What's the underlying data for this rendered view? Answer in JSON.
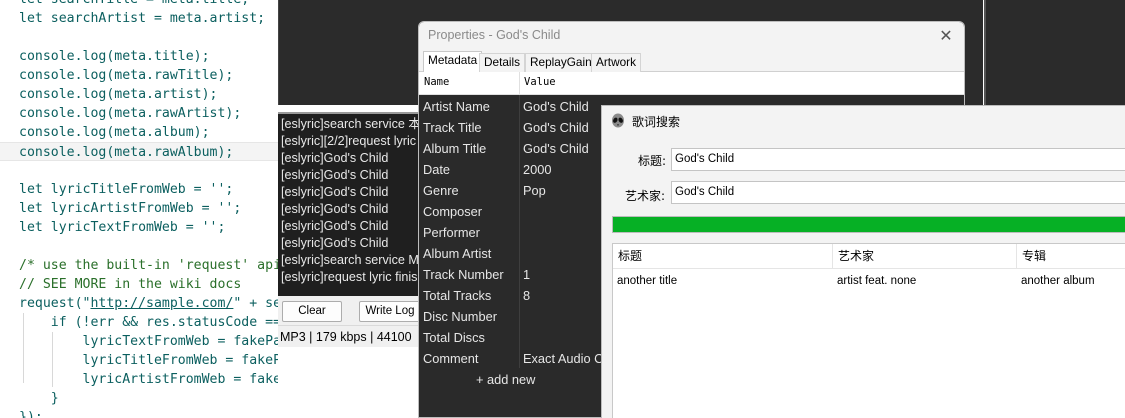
{
  "editor": {
    "lines": [
      "let searchTitle = meta.title;",
      "let searchArtist = meta.artist;",
      "",
      "console.log(meta.title);",
      "console.log(meta.rawTitle);",
      "console.log(meta.artist);",
      "console.log(meta.rawArtist);",
      "console.log(meta.album);",
      "console.log(meta.rawAlbum);",
      "",
      "let lyricTitleFromWeb = '';",
      "let lyricArtistFromWeb = '';",
      "let lyricTextFromWeb = '';",
      "",
      "/* use the built-in 'request' api",
      "// SEE MORE in the wiki docs",
      "request(\"http://sample.com/\" + sea",
      "    if (!err && res.statusCode ==",
      "        lyricTextFromWeb = fakePar",
      "        lyricTitleFromWeb = fakeParse(body);",
      "        lyricArtistFromWeb = fakeParse(body);",
      "    }",
      "});"
    ]
  },
  "console": {
    "lines": [
      "[eslyric]search service 本",
      "[eslyric][2/2]request lyric",
      "[eslyric]God's Child",
      "[eslyric]God's Child",
      "[eslyric]God's Child",
      "[eslyric]God's Child",
      "[eslyric]God's Child",
      "[eslyric]God's Child",
      "[eslyric]search service M",
      "[eslyric]request lyric finis"
    ],
    "clear_label": "Clear",
    "write_log_label": "Write Log",
    "status": "MP3 | 179 kbps | 44100"
  },
  "properties": {
    "title": "Properties - God's Child",
    "close_glyph": "✕",
    "tabs": [
      "Metadata",
      "Details",
      "ReplayGain",
      "Artwork"
    ],
    "col_name": "Name",
    "col_value": "Value",
    "rows": [
      {
        "name": "Artist Name",
        "value": "God's Child"
      },
      {
        "name": "Track Title",
        "value": "God's Child"
      },
      {
        "name": "Album Title",
        "value": "God's Child"
      },
      {
        "name": "Date",
        "value": "2000"
      },
      {
        "name": "Genre",
        "value": "Pop"
      },
      {
        "name": "Composer",
        "value": ""
      },
      {
        "name": "Performer",
        "value": ""
      },
      {
        "name": "Album Artist",
        "value": ""
      },
      {
        "name": "Track Number",
        "value": "1"
      },
      {
        "name": "Total Tracks",
        "value": "8"
      },
      {
        "name": "Disc Number",
        "value": ""
      },
      {
        "name": "Total Discs",
        "value": ""
      },
      {
        "name": "Comment",
        "value": "Exact Audio C"
      }
    ],
    "add_new": "+ add new"
  },
  "lyric_search": {
    "title": "歌词搜索",
    "title_label": "标题:",
    "title_value": "God's Child",
    "artist_label": "艺术家:",
    "artist_value": "God's Child",
    "progress": 1.0,
    "progress_color": "#06b025",
    "columns": [
      "标题",
      "艺术家",
      "专辑"
    ],
    "results": [
      {
        "title": "another title",
        "artist": "artist feat. none",
        "album": "another album"
      }
    ]
  }
}
